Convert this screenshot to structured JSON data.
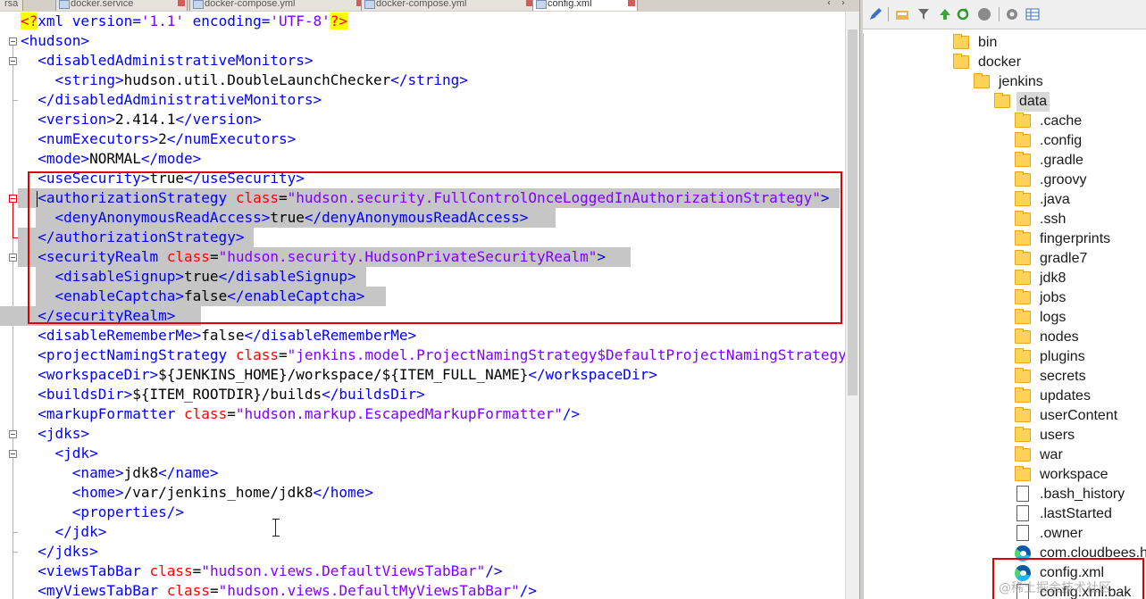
{
  "tabs": [
    {
      "label": "rsa",
      "active": false
    },
    {
      "label": "docker.service",
      "active": false
    },
    {
      "label": "docker-compose.yml",
      "active": false
    },
    {
      "label": "docker-compose.yml",
      "active": false
    },
    {
      "label": "config.xml",
      "active": true
    }
  ],
  "code_lines": [
    [
      [
        "pi",
        "<?"
      ],
      [
        "tg",
        "xml version="
      ],
      [
        "sv",
        "'1.1'"
      ],
      [
        "tg",
        " encoding="
      ],
      [
        "sv",
        "'UTF-8'"
      ],
      [
        "pi",
        "?>"
      ]
    ],
    [
      [
        "tg",
        "<hudson>"
      ]
    ],
    [
      [
        "tx",
        "  "
      ],
      [
        "tg",
        "<disabledAdministrativeMonitors>"
      ]
    ],
    [
      [
        "tx",
        "    "
      ],
      [
        "tg",
        "<string>"
      ],
      [
        "tx",
        "hudson.util.DoubleLaunchChecker"
      ],
      [
        "tg",
        "</string>"
      ]
    ],
    [
      [
        "tx",
        "  "
      ],
      [
        "tg",
        "</disabledAdministrativeMonitors>"
      ]
    ],
    [
      [
        "tx",
        "  "
      ],
      [
        "tg",
        "<version>"
      ],
      [
        "tx",
        "2.414.1"
      ],
      [
        "tg",
        "</version>"
      ]
    ],
    [
      [
        "tx",
        "  "
      ],
      [
        "tg",
        "<numExecutors>"
      ],
      [
        "tx",
        "2"
      ],
      [
        "tg",
        "</numExecutors>"
      ]
    ],
    [
      [
        "tx",
        "  "
      ],
      [
        "tg",
        "<mode>"
      ],
      [
        "tx",
        "NORMAL"
      ],
      [
        "tg",
        "</mode>"
      ]
    ],
    [
      [
        "tx",
        "  "
      ],
      [
        "tg",
        "<useSecurity>"
      ],
      [
        "tx",
        "true"
      ],
      [
        "tg",
        "</useSecurity>"
      ]
    ],
    [
      [
        "tx",
        "  "
      ],
      [
        "tg",
        "<authorizationStrategy "
      ],
      [
        "at",
        "class"
      ],
      [
        "tx",
        "="
      ],
      [
        "sv",
        "\"hudson.security.FullControlOnceLoggedInAuthorizationStrategy\""
      ],
      [
        "tg",
        ">"
      ]
    ],
    [
      [
        "tx",
        "    "
      ],
      [
        "tg",
        "<denyAnonymousReadAccess>"
      ],
      [
        "tx",
        "true"
      ],
      [
        "tg",
        "</denyAnonymousReadAccess>"
      ]
    ],
    [
      [
        "tx",
        "  "
      ],
      [
        "tg",
        "</authorizationStrategy>"
      ]
    ],
    [
      [
        "tx",
        "  "
      ],
      [
        "tg",
        "<securityRealm "
      ],
      [
        "at",
        "class"
      ],
      [
        "tx",
        "="
      ],
      [
        "sv",
        "\"hudson.security.HudsonPrivateSecurityRealm\""
      ],
      [
        "tg",
        ">"
      ]
    ],
    [
      [
        "tx",
        "    "
      ],
      [
        "tg",
        "<disableSignup>"
      ],
      [
        "tx",
        "true"
      ],
      [
        "tg",
        "</disableSignup>"
      ]
    ],
    [
      [
        "tx",
        "    "
      ],
      [
        "tg",
        "<enableCaptcha>"
      ],
      [
        "tx",
        "false"
      ],
      [
        "tg",
        "</enableCaptcha>"
      ]
    ],
    [
      [
        "tx",
        "  "
      ],
      [
        "tg",
        "</securityRealm>"
      ]
    ],
    [
      [
        "tx",
        "  "
      ],
      [
        "tg",
        "<disableRememberMe>"
      ],
      [
        "tx",
        "false"
      ],
      [
        "tg",
        "</disableRememberMe>"
      ]
    ],
    [
      [
        "tx",
        "  "
      ],
      [
        "tg",
        "<projectNamingStrategy "
      ],
      [
        "at",
        "class"
      ],
      [
        "tx",
        "="
      ],
      [
        "sv",
        "\"jenkins.model.ProjectNamingStrategy$DefaultProjectNamingStrategy\""
      ],
      [
        "tg",
        "/>"
      ]
    ],
    [
      [
        "tx",
        "  "
      ],
      [
        "tg",
        "<workspaceDir>"
      ],
      [
        "tx",
        "${JENKINS_HOME}/workspace/${ITEM_FULL_NAME}"
      ],
      [
        "tg",
        "</workspaceDir>"
      ]
    ],
    [
      [
        "tx",
        "  "
      ],
      [
        "tg",
        "<buildsDir>"
      ],
      [
        "tx",
        "${ITEM_ROOTDIR}/builds"
      ],
      [
        "tg",
        "</buildsDir>"
      ]
    ],
    [
      [
        "tx",
        "  "
      ],
      [
        "tg",
        "<markupFormatter "
      ],
      [
        "at",
        "class"
      ],
      [
        "tx",
        "="
      ],
      [
        "sv",
        "\"hudson.markup.EscapedMarkupFormatter\""
      ],
      [
        "tg",
        "/>"
      ]
    ],
    [
      [
        "tx",
        "  "
      ],
      [
        "tg",
        "<jdks>"
      ]
    ],
    [
      [
        "tx",
        "    "
      ],
      [
        "tg",
        "<jdk>"
      ]
    ],
    [
      [
        "tx",
        "      "
      ],
      [
        "tg",
        "<name>"
      ],
      [
        "tx",
        "jdk8"
      ],
      [
        "tg",
        "</name>"
      ]
    ],
    [
      [
        "tx",
        "      "
      ],
      [
        "tg",
        "<home>"
      ],
      [
        "tx",
        "/var/jenkins_home/jdk8"
      ],
      [
        "tg",
        "</home>"
      ]
    ],
    [
      [
        "tx",
        "      "
      ],
      [
        "tg",
        "<properties/>"
      ]
    ],
    [
      [
        "tx",
        "    "
      ],
      [
        "tg",
        "</jdk>"
      ]
    ],
    [
      [
        "tx",
        "  "
      ],
      [
        "tg",
        "</jdks>"
      ]
    ],
    [
      [
        "tx",
        "  "
      ],
      [
        "tg",
        "<viewsTabBar "
      ],
      [
        "at",
        "class"
      ],
      [
        "tx",
        "="
      ],
      [
        "sv",
        "\"hudson.views.DefaultViewsTabBar\""
      ],
      [
        "tg",
        "/>"
      ]
    ],
    [
      [
        "tx",
        "  "
      ],
      [
        "tg",
        "<myViewsTabBar "
      ],
      [
        "at",
        "class"
      ],
      [
        "tx",
        "="
      ],
      [
        "sv",
        "\"hudson.views.DefaultMyViewsTabBar\""
      ],
      [
        "tg",
        "/>"
      ]
    ]
  ],
  "tree": [
    {
      "label": "bin",
      "type": "folder",
      "depth": 0
    },
    {
      "label": "docker",
      "type": "folder",
      "depth": 0
    },
    {
      "label": "jenkins",
      "type": "folder",
      "depth": 1
    },
    {
      "label": "data",
      "type": "folder",
      "depth": 2,
      "selected": true
    },
    {
      "label": ".cache",
      "type": "folder",
      "depth": 3
    },
    {
      "label": ".config",
      "type": "folder",
      "depth": 3
    },
    {
      "label": ".gradle",
      "type": "folder",
      "depth": 3
    },
    {
      "label": ".groovy",
      "type": "folder",
      "depth": 3
    },
    {
      "label": ".java",
      "type": "folder",
      "depth": 3
    },
    {
      "label": ".ssh",
      "type": "folder",
      "depth": 3
    },
    {
      "label": "fingerprints",
      "type": "folder",
      "depth": 3
    },
    {
      "label": "gradle7",
      "type": "folder",
      "depth": 3
    },
    {
      "label": "jdk8",
      "type": "folder",
      "depth": 3
    },
    {
      "label": "jobs",
      "type": "folder",
      "depth": 3
    },
    {
      "label": "logs",
      "type": "folder",
      "depth": 3
    },
    {
      "label": "nodes",
      "type": "folder",
      "depth": 3
    },
    {
      "label": "plugins",
      "type": "folder",
      "depth": 3
    },
    {
      "label": "secrets",
      "type": "folder",
      "depth": 3
    },
    {
      "label": "updates",
      "type": "folder",
      "depth": 3
    },
    {
      "label": "userContent",
      "type": "folder",
      "depth": 3
    },
    {
      "label": "users",
      "type": "folder",
      "depth": 3
    },
    {
      "label": "war",
      "type": "folder",
      "depth": 3
    },
    {
      "label": "workspace",
      "type": "folder",
      "depth": 3
    },
    {
      "label": ".bash_history",
      "type": "file",
      "depth": 3
    },
    {
      "label": ".lastStarted",
      "type": "file",
      "depth": 3
    },
    {
      "label": ".owner",
      "type": "file",
      "depth": 3
    },
    {
      "label": "com.cloudbees.h",
      "type": "edge-file",
      "depth": 3
    },
    {
      "label": "config.xml",
      "type": "edge-file",
      "depth": 3
    },
    {
      "label": "config.xml.bak",
      "type": "file",
      "depth": 3
    }
  ],
  "watermark": "@稀土掘金技术社区",
  "colors": {
    "tag": "#0000ff",
    "attr": "#ff0000",
    "string": "#8000ff",
    "selection": "#c6c6c6",
    "highlight_box": "#e00000",
    "folder": "#ffd258"
  }
}
